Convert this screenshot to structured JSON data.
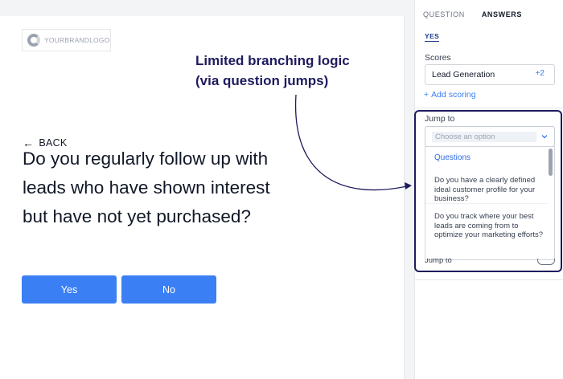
{
  "preview": {
    "logo_text": "YOURBRANDLOGO",
    "back_label": "BACK",
    "question_text": "Do you regularly follow up with leads who have shown interest but have not yet purchased?",
    "answers": [
      {
        "label": "Yes"
      },
      {
        "label": "No"
      }
    ]
  },
  "annotation": {
    "line1": "Limited branching logic",
    "line2": "(via question  jumps)",
    "color": "#1e1b5e"
  },
  "panel": {
    "tabs": [
      {
        "label": "QUESTION",
        "active": false
      },
      {
        "label": "ANSWERS",
        "active": true
      }
    ],
    "selected_answer": "YES",
    "scores_label": "Scores",
    "score_value": "Lead Generation",
    "score_extra": "+2",
    "add_scoring_label": "Add scoring",
    "jump_to_label": "Jump to",
    "jump_to_placeholder": "Choose an option",
    "dropdown": {
      "header": "Questions",
      "options": [
        "Do you have a clearly defined ideal customer profile for your business?",
        "Do you track where your best leads are coming from to optimize your marketing efforts?"
      ]
    },
    "peek_label": "Jump to"
  },
  "colors": {
    "accent": "#3b7ff5",
    "annotation": "#1e1b5e"
  }
}
